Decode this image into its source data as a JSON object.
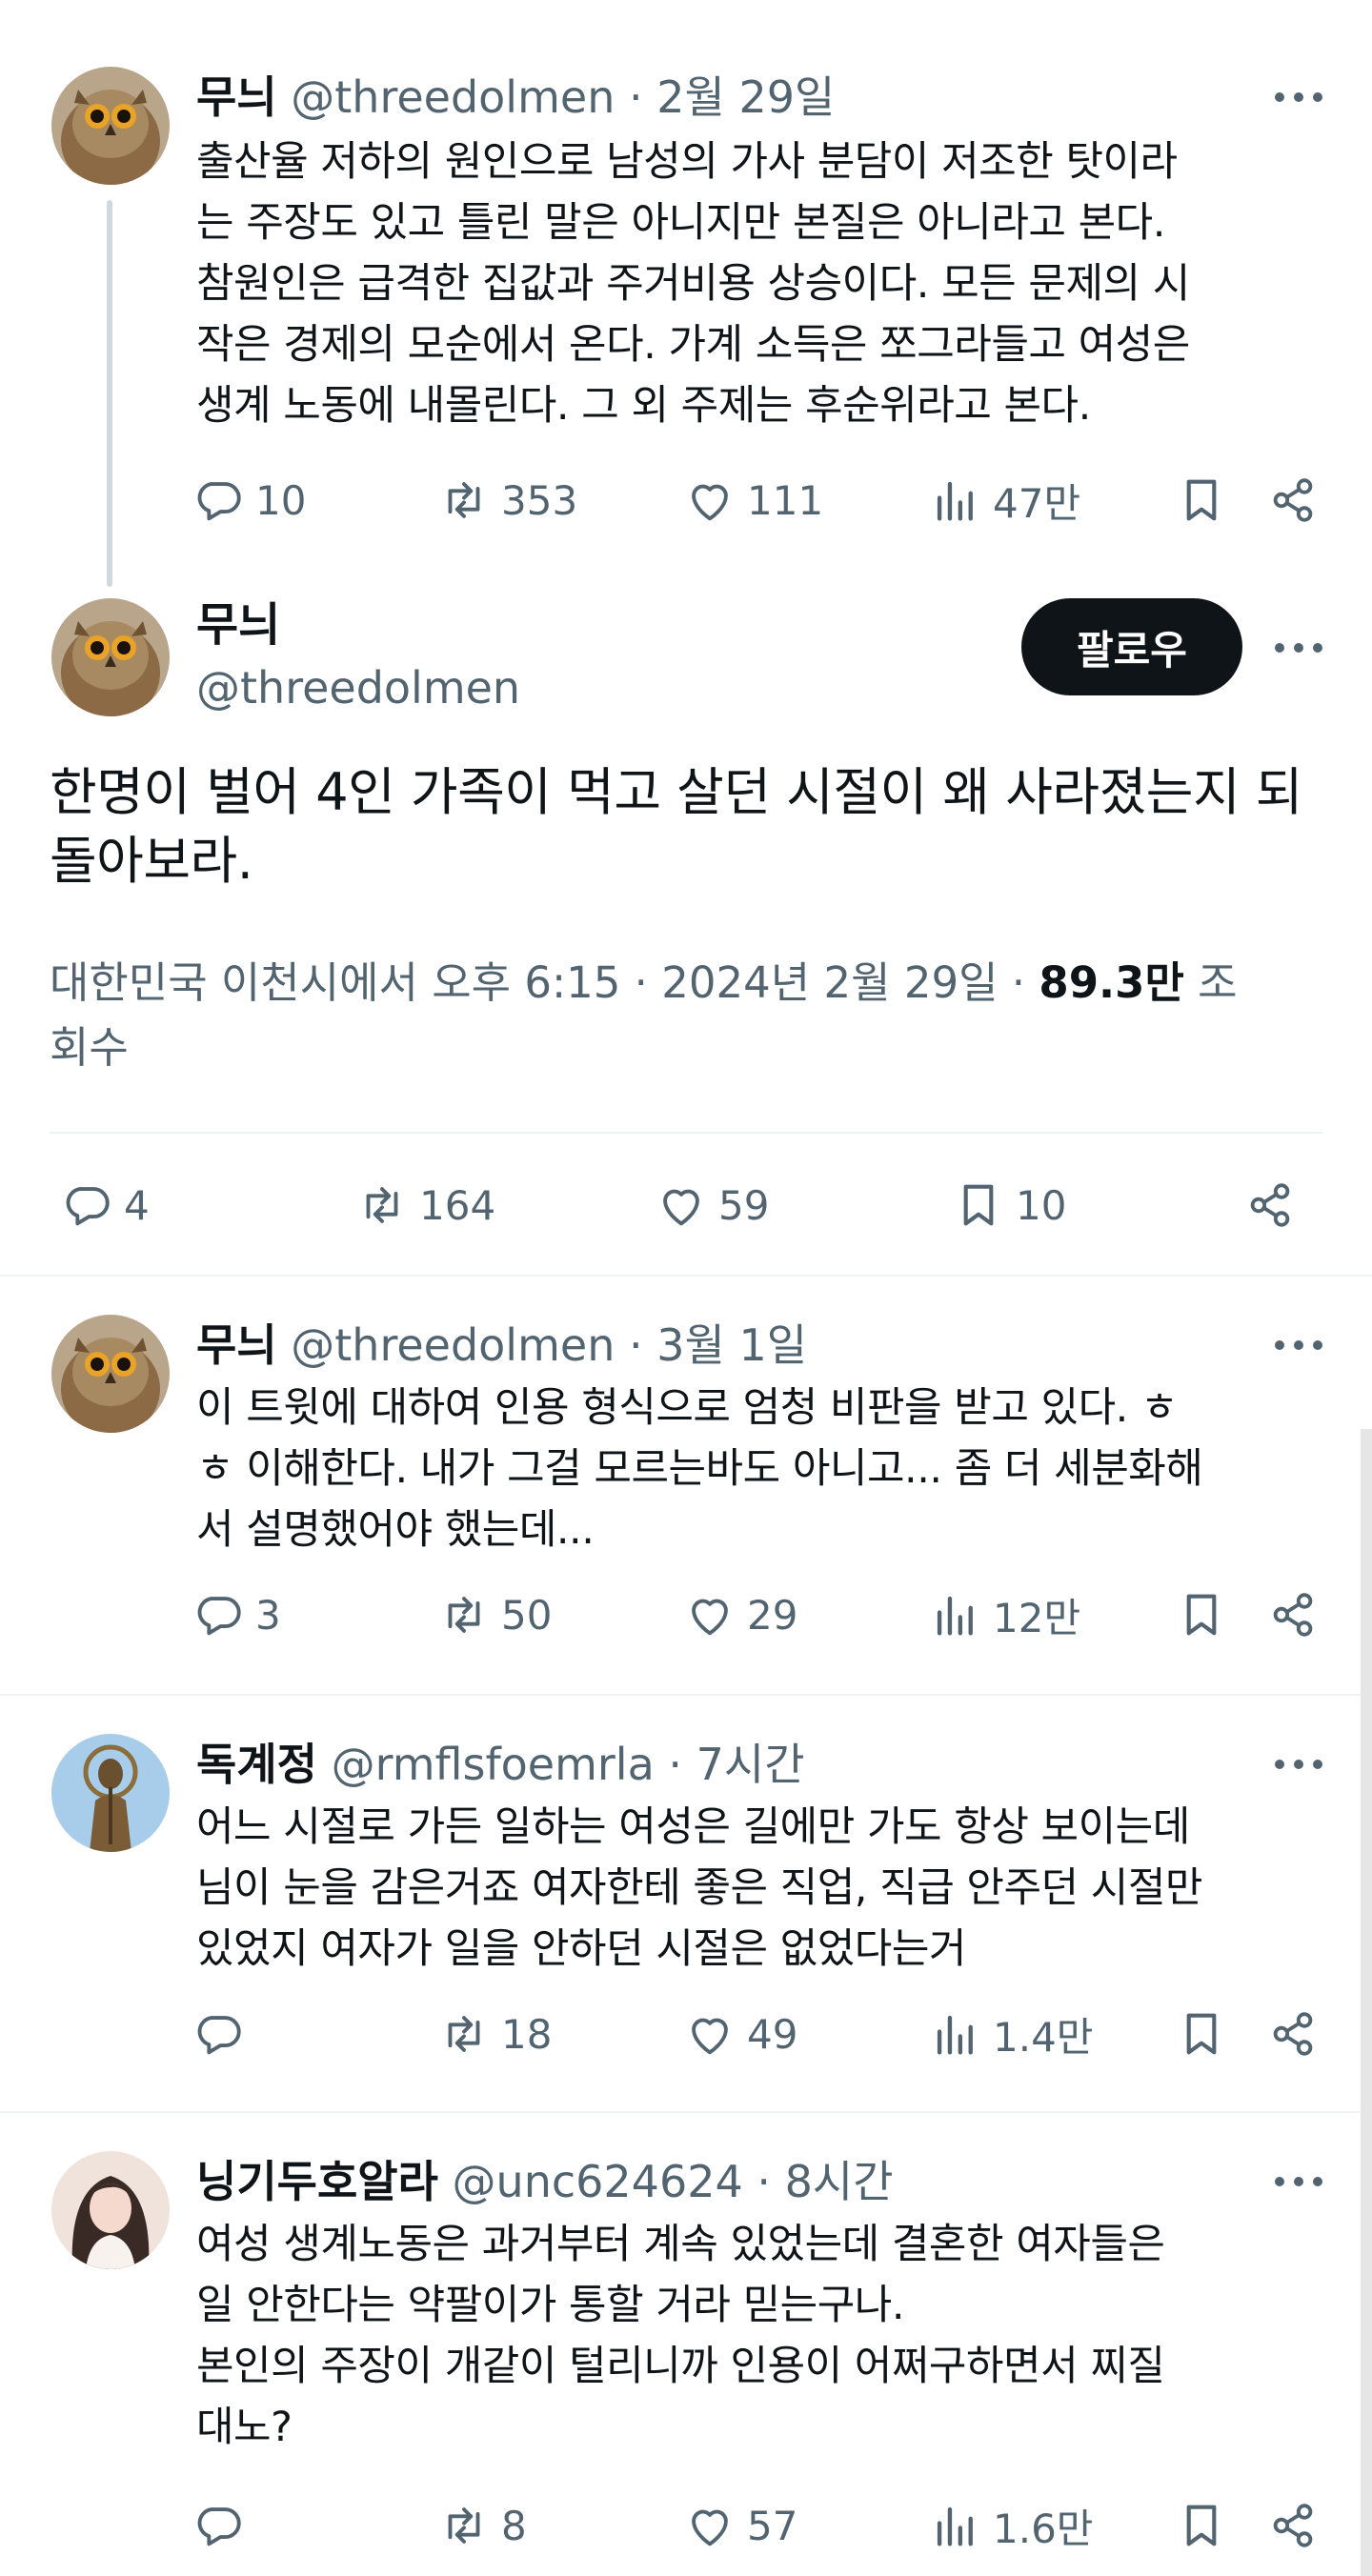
{
  "colors": {
    "text": "#0f1419",
    "secondary": "#536471",
    "follow_bg": "#0f1419",
    "follow_text": "#ffffff",
    "divider": "#eff3f4",
    "thread_line": "#cfd9de"
  },
  "tweets": [
    {
      "name": "무늬",
      "handle": "@threedolmen",
      "separator": "·",
      "time": "2월 29일",
      "text": "출산율 저하의 원인으로 남성의 가사 분담이 저조한 탓이라\n는 주장도 있고 틀린 말은 아니지만 본질은 아니라고 본다.\n참원인은 급격한 집값과 주거비용 상승이다. 모든 문제의 시\n작은 경제의 모순에서 온다.  가계 소득은 쪼그라들고 여성은\n생계 노동에 내몰린다. 그 외 주제는 후순위라고 본다.",
      "replies": "10",
      "retweets": "353",
      "likes": "111",
      "views": "47만",
      "avatar_icon": "owl-avatar-icon"
    },
    {
      "name": "무늬",
      "handle": "@threedolmen",
      "separator": "·",
      "time": "3월 1일",
      "text": "이 트윗에 대하여 인용 형식으로 엄청 비판을 받고 있다. ㅎ\nㅎ 이해한다. 내가 그걸 모르는바도 아니고... 좀 더 세분화해\n서 설명했어야 했는데...",
      "replies": "3",
      "retweets": "50",
      "likes": "29",
      "views": "12만",
      "avatar_icon": "owl-avatar-icon"
    },
    {
      "name": "독계정",
      "handle": "@rmflsfoemrla",
      "separator": "·",
      "time": "7시간",
      "text": "어느 시절로 가든 일하는 여성은 길에만 가도 항상 보이는데\n님이 눈을 감은거죠 여자한테 좋은 직업, 직급 안주던 시절만\n있었지 여자가 일을 안하던 시절은 없었다는거",
      "replies": "",
      "retweets": "18",
      "likes": "49",
      "views": "1.4만",
      "avatar_icon": "statue-avatar-icon"
    },
    {
      "name": "닝기두호알라",
      "handle": "@unc624624",
      "separator": "·",
      "time": "8시간",
      "text": "여성 생계노동은 과거부터 계속 있었는데 결혼한 여자들은\n일 안한다는 약팔이가 통할 거라 믿는구나.\n본인의 주장이 개같이 털리니까 인용이 어쩌구하면서 찌질\n대노?",
      "replies": "",
      "retweets": "8",
      "likes": "57",
      "views": "1.6만",
      "avatar_icon": "girl-avatar-icon"
    }
  ],
  "main": {
    "name": "무늬",
    "handle": "@threedolmen",
    "follow_label": "팔로우",
    "text": "한명이 벌어 4인 가족이 먹고 살던 시절이 왜 사라졌는지 되\n돌아보라.",
    "meta_prefix": "대한민국 이천시에서 오후 6:15 · 2024년 2월 29일 · ",
    "views_count": "89.3만",
    "views_label": " 조\n회수",
    "replies": "4",
    "retweets": "164",
    "likes": "59",
    "bookmarks": "10"
  }
}
